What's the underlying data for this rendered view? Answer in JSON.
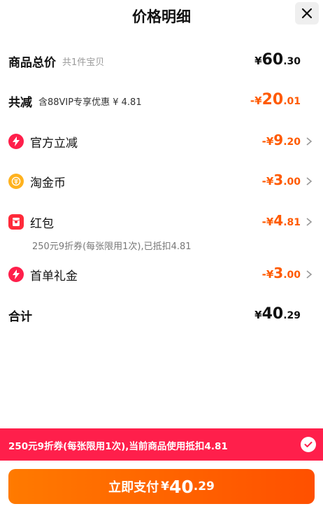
{
  "header": {
    "title": "价格明细"
  },
  "colors": {
    "accent_orange": "#ff5a00",
    "coupon_red": "#ff1f4b",
    "pay_orange": "#ff6a00"
  },
  "total": {
    "label": "商品总价",
    "sub": "共1件宝贝",
    "currency": "¥",
    "int": "60",
    "dec": ".30"
  },
  "discount": {
    "label": "共减",
    "sub": "含88VIP专享优惠 ¥ 4.81",
    "currency": "-¥",
    "int": "20",
    "dec": ".01"
  },
  "items": [
    {
      "label": "官方立减",
      "icon": "lightning-icon",
      "currency": "-¥",
      "int": "9",
      "dec": ".20"
    },
    {
      "label": "淘金币",
      "icon": "coin-icon",
      "currency": "-¥",
      "int": "3",
      "dec": ".00"
    },
    {
      "label": "红包",
      "icon": "red-envelope-icon",
      "currency": "-¥",
      "int": "4",
      "dec": ".81",
      "detail": "250元9折券(每张限用1次),已抵扣4.81"
    },
    {
      "label": "首单礼金",
      "icon": "lightning-icon",
      "currency": "-¥",
      "int": "3",
      "dec": ".00"
    }
  ],
  "sum": {
    "label": "合计",
    "currency": "¥",
    "int": "40",
    "dec": ".29"
  },
  "coupon_bar": {
    "text": "250元9折券(每张限用1次),当前商品使用抵扣4.81"
  },
  "pay": {
    "label": "立即支付",
    "currency": "¥",
    "int": "40",
    "dec": ".29"
  }
}
